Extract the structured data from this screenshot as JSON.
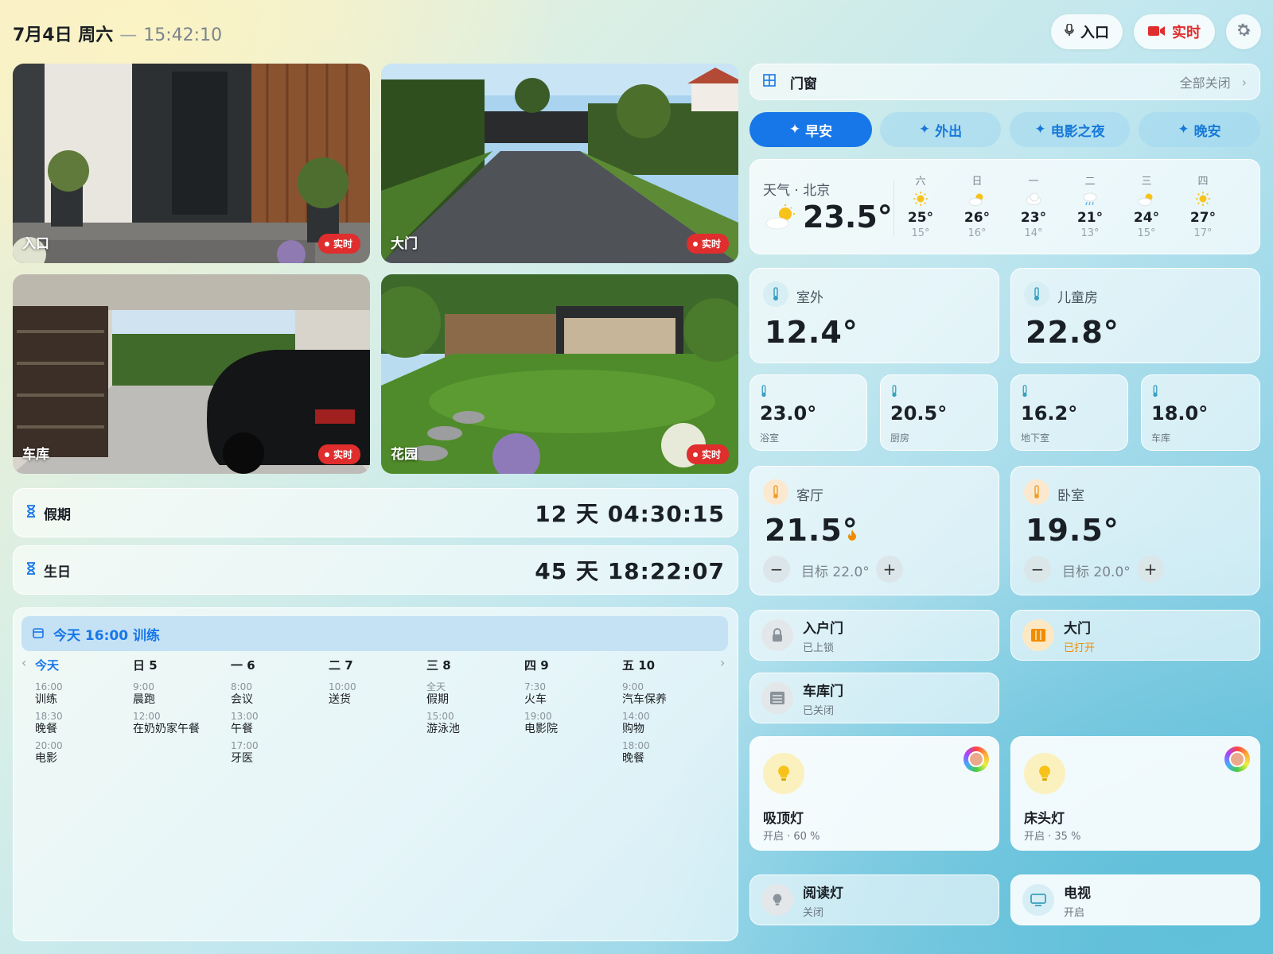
{
  "header": {
    "date": "7月4日 周六",
    "separator": "—",
    "time": "15:42:10",
    "mic_button_label": "入口",
    "live_button_label": "实时"
  },
  "cameras": [
    {
      "label": "入口",
      "live": "实时"
    },
    {
      "label": "大门",
      "live": "实时"
    },
    {
      "label": "车库",
      "live": "实时"
    },
    {
      "label": "花园",
      "live": "实时"
    }
  ],
  "countdowns": [
    {
      "title": "假期",
      "value": "12 天 04:30:15"
    },
    {
      "title": "生日",
      "value": "45 天 18:22:07"
    }
  ],
  "calendar": {
    "banner": "今天 16:00 训练",
    "days": [
      {
        "label": "今天",
        "events": [
          {
            "time": "16:00",
            "name": "训练"
          },
          {
            "time": "18:30",
            "name": "晚餐"
          },
          {
            "time": "20:00",
            "name": "电影"
          }
        ]
      },
      {
        "label": "日 5",
        "events": [
          {
            "time": "9:00",
            "name": "晨跑"
          },
          {
            "time": "12:00",
            "name": "在奶奶家午餐"
          }
        ]
      },
      {
        "label": "一 6",
        "events": [
          {
            "time": "8:00",
            "name": "会议"
          },
          {
            "time": "13:00",
            "name": "午餐"
          },
          {
            "time": "17:00",
            "name": "牙医"
          }
        ]
      },
      {
        "label": "二 7",
        "events": [
          {
            "time": "10:00",
            "name": "送货"
          }
        ]
      },
      {
        "label": "三 8",
        "events": [
          {
            "time": "全天",
            "name": "假期"
          },
          {
            "time": "15:00",
            "name": "游泳池"
          }
        ]
      },
      {
        "label": "四 9",
        "events": [
          {
            "time": "7:30",
            "name": "火车"
          },
          {
            "time": "19:00",
            "name": "电影院"
          }
        ]
      },
      {
        "label": "五 10",
        "events": [
          {
            "time": "9:00",
            "name": "汽车保养"
          },
          {
            "time": "14:00",
            "name": "购物"
          },
          {
            "time": "18:00",
            "name": "晚餐"
          }
        ]
      }
    ]
  },
  "windows_bar": {
    "title": "门窗",
    "action": "全部关闭"
  },
  "scenes": [
    "早安",
    "外出",
    "电影之夜",
    "晚安"
  ],
  "weather": {
    "title": "天气 · 北京",
    "current": "23.5°",
    "forecast": [
      {
        "day": "六",
        "icon": "sun-icon",
        "high": "25°",
        "low": "15°"
      },
      {
        "day": "日",
        "icon": "partly-cloudy-icon",
        "high": "26°",
        "low": "16°"
      },
      {
        "day": "一",
        "icon": "cloud-icon",
        "high": "23°",
        "low": "14°"
      },
      {
        "day": "二",
        "icon": "rain-icon",
        "high": "21°",
        "low": "13°"
      },
      {
        "day": "三",
        "icon": "partly-cloudy-icon",
        "high": "24°",
        "low": "15°"
      },
      {
        "day": "四",
        "icon": "sun-icon",
        "high": "27°",
        "low": "17°"
      }
    ]
  },
  "temps_big": [
    {
      "name": "室外",
      "value": "12.4°"
    },
    {
      "name": "儿童房",
      "value": "22.8°"
    }
  ],
  "temps_small": [
    {
      "value": "23.0°",
      "name": "浴室"
    },
    {
      "value": "20.5°",
      "name": "厨房"
    },
    {
      "value": "16.2°",
      "name": "地下室"
    },
    {
      "value": "18.0°",
      "name": "车库"
    }
  ],
  "thermostats": [
    {
      "name": "客厅",
      "value": "21.5°",
      "target": "目标 22.0°",
      "heating": true
    },
    {
      "name": "卧室",
      "value": "19.5°",
      "target": "目标 20.0°",
      "heating": false
    }
  ],
  "doors": [
    {
      "name": "入户门",
      "status": "已上锁"
    },
    {
      "name": "大门",
      "status": "已打开"
    },
    {
      "name": "车库门",
      "status": "已关闭"
    }
  ],
  "lights": [
    {
      "name": "吸顶灯",
      "status": "开启 · 60 %"
    },
    {
      "name": "床头灯",
      "status": "开启 · 35 %"
    }
  ],
  "devices": [
    {
      "name": "阅读灯",
      "status": "关闭"
    },
    {
      "name": "电视",
      "status": "开启"
    }
  ],
  "colors": {
    "accent": "#1877e8",
    "live": "#e02d2d",
    "open": "#f08c00"
  }
}
